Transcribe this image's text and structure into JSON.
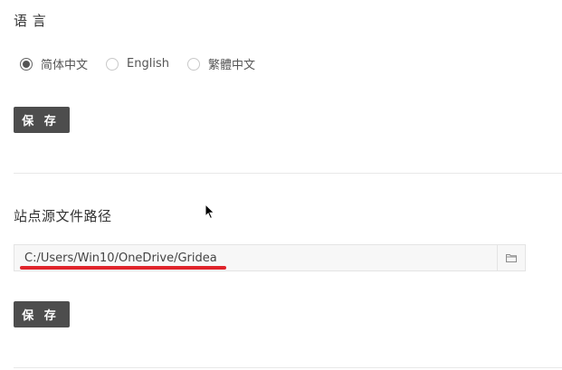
{
  "language": {
    "title": "语 言",
    "options": [
      {
        "label": "简体中文",
        "checked": true
      },
      {
        "label": "English",
        "checked": false
      },
      {
        "label": "繁體中文",
        "checked": false
      }
    ],
    "save_label": "保 存"
  },
  "source_path": {
    "title": "站点源文件路径",
    "value": "C:/Users/Win10/OneDrive/Gridea",
    "browse_icon": "folder-icon",
    "save_label": "保 存"
  },
  "annotation": {
    "underline_color": "#e0242b"
  },
  "colors": {
    "button_bg": "#4d4d4d",
    "divider": "#e8e8e8"
  }
}
